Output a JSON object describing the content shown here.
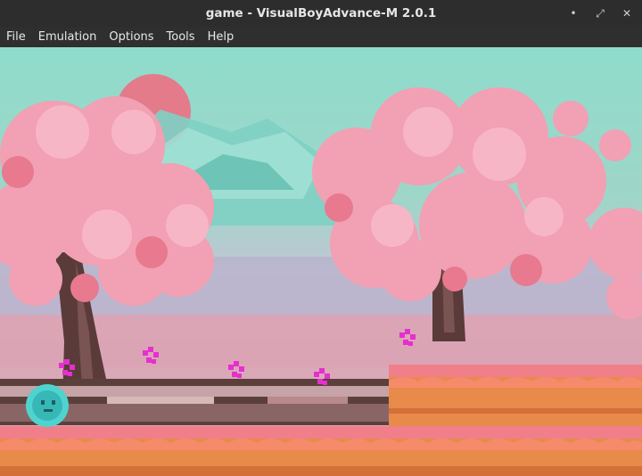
{
  "window": {
    "title": "game - VisualBoyAdvance-M 2.0.1",
    "controls": [
      {
        "name": "minimize",
        "glyph": "•"
      },
      {
        "name": "maximize",
        "glyph": "⤢"
      },
      {
        "name": "close",
        "glyph": "✕"
      }
    ]
  },
  "menu": {
    "items": [
      "File",
      "Emulation",
      "Options",
      "Tools",
      "Help"
    ]
  },
  "game": {
    "colors": {
      "sky_top": "#8fdccc",
      "sky_band": "#c9c4d4",
      "blossom": "#f2a0b3",
      "blossom_dark": "#e8798f",
      "trunk": "#5a3b3a",
      "ground_top": "#f07f8a",
      "ground_orange": "#e88a4a",
      "flower": "#e52fd0",
      "player": "#4fd3cf"
    }
  }
}
